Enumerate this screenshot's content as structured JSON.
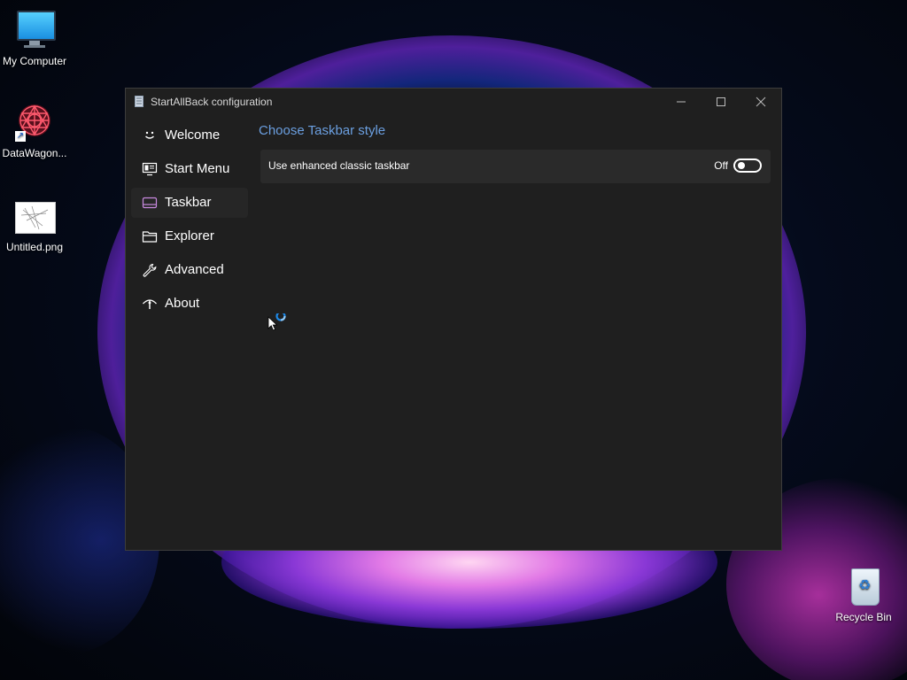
{
  "desktop": {
    "icons": [
      {
        "label": "My Computer"
      },
      {
        "label": "DataWagon..."
      },
      {
        "label": "Untitled.png"
      },
      {
        "label": "Recycle Bin"
      }
    ]
  },
  "window": {
    "title": "StartAllBack configuration",
    "nav": [
      {
        "label": "Welcome",
        "icon": "smiley-icon"
      },
      {
        "label": "Start Menu",
        "icon": "start-menu-icon"
      },
      {
        "label": "Taskbar",
        "icon": "taskbar-icon",
        "active": true
      },
      {
        "label": "Explorer",
        "icon": "folder-icon"
      },
      {
        "label": "Advanced",
        "icon": "wrench-icon"
      },
      {
        "label": "About",
        "icon": "about-icon"
      }
    ],
    "content": {
      "section_title": "Choose Taskbar style",
      "setting": {
        "label": "Use enhanced classic taskbar",
        "state": "Off"
      }
    }
  },
  "colors": {
    "accent": "#6b9fe0",
    "window_bg": "#1f1f1f",
    "active_item_bg": "#262626",
    "taskbar_icon": "#c98ae0"
  }
}
